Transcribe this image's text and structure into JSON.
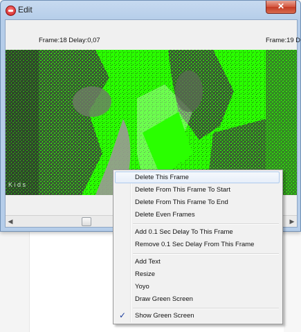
{
  "window": {
    "title": "Edit",
    "close_label": "✕"
  },
  "frames": [
    {
      "label": "Frame:18 Delay:0,07"
    },
    {
      "label": "Frame:19 D"
    }
  ],
  "watermark_text": "K  i  d  s",
  "colors": {
    "green_screen": "#2aff00",
    "menu_background": "#f1f1f1",
    "menu_highlight": "#e6eef9",
    "checkmark": "#1a3b9c"
  },
  "context_menu": {
    "items": [
      {
        "label": "Delete This Frame",
        "highlighted": true
      },
      {
        "label": "Delete From This Frame To Start"
      },
      {
        "label": "Delete From This Frame To End"
      },
      {
        "label": "Delete Even Frames"
      },
      {
        "label": "Add 0.1 Sec Delay To This Frame"
      },
      {
        "label": "Remove 0.1 Sec Delay From This Frame"
      },
      {
        "label": "Add Text"
      },
      {
        "label": "Resize"
      },
      {
        "label": "Yoyo"
      },
      {
        "label": "Draw Green Screen"
      },
      {
        "label": "Show Green Screen",
        "checked": true,
        "check_glyph": "✓"
      }
    ]
  }
}
